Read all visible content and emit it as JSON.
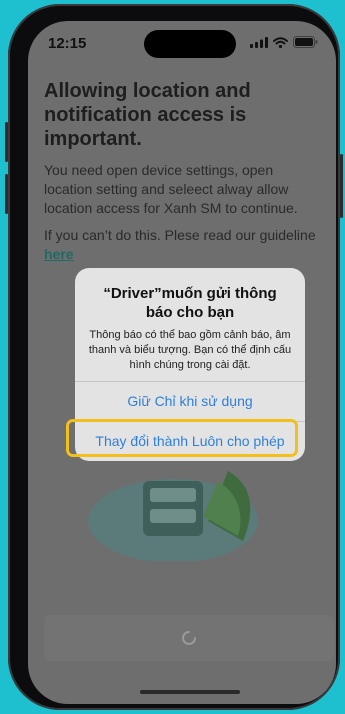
{
  "status_bar": {
    "time": "12:15"
  },
  "content": {
    "heading": "Allowing location and notification access is important.",
    "description": "You need open device settings, open location setting and seleect  alway allow location access for Xanh SM to continue.",
    "guideline_text": "If you can’t do this. Plese read our guideline ",
    "guideline_link": "here"
  },
  "alert": {
    "title": "“Driver”muốn gửi thông báo cho bạn",
    "message": "Thông báo có thể bao gồm cảnh báo, âm thanh và biểu tượng. Bạn có thể định cấu hình chúng trong cài đặt.",
    "option_keep": "Giữ Chỉ khi sử dụng",
    "option_always": "Thay đổi thành Luôn cho phép"
  },
  "colors": {
    "background": "#1ec0d0",
    "overlay": "#6e6e6e",
    "alert_link": "#2f7fd8",
    "highlight": "#f2bf1c"
  }
}
